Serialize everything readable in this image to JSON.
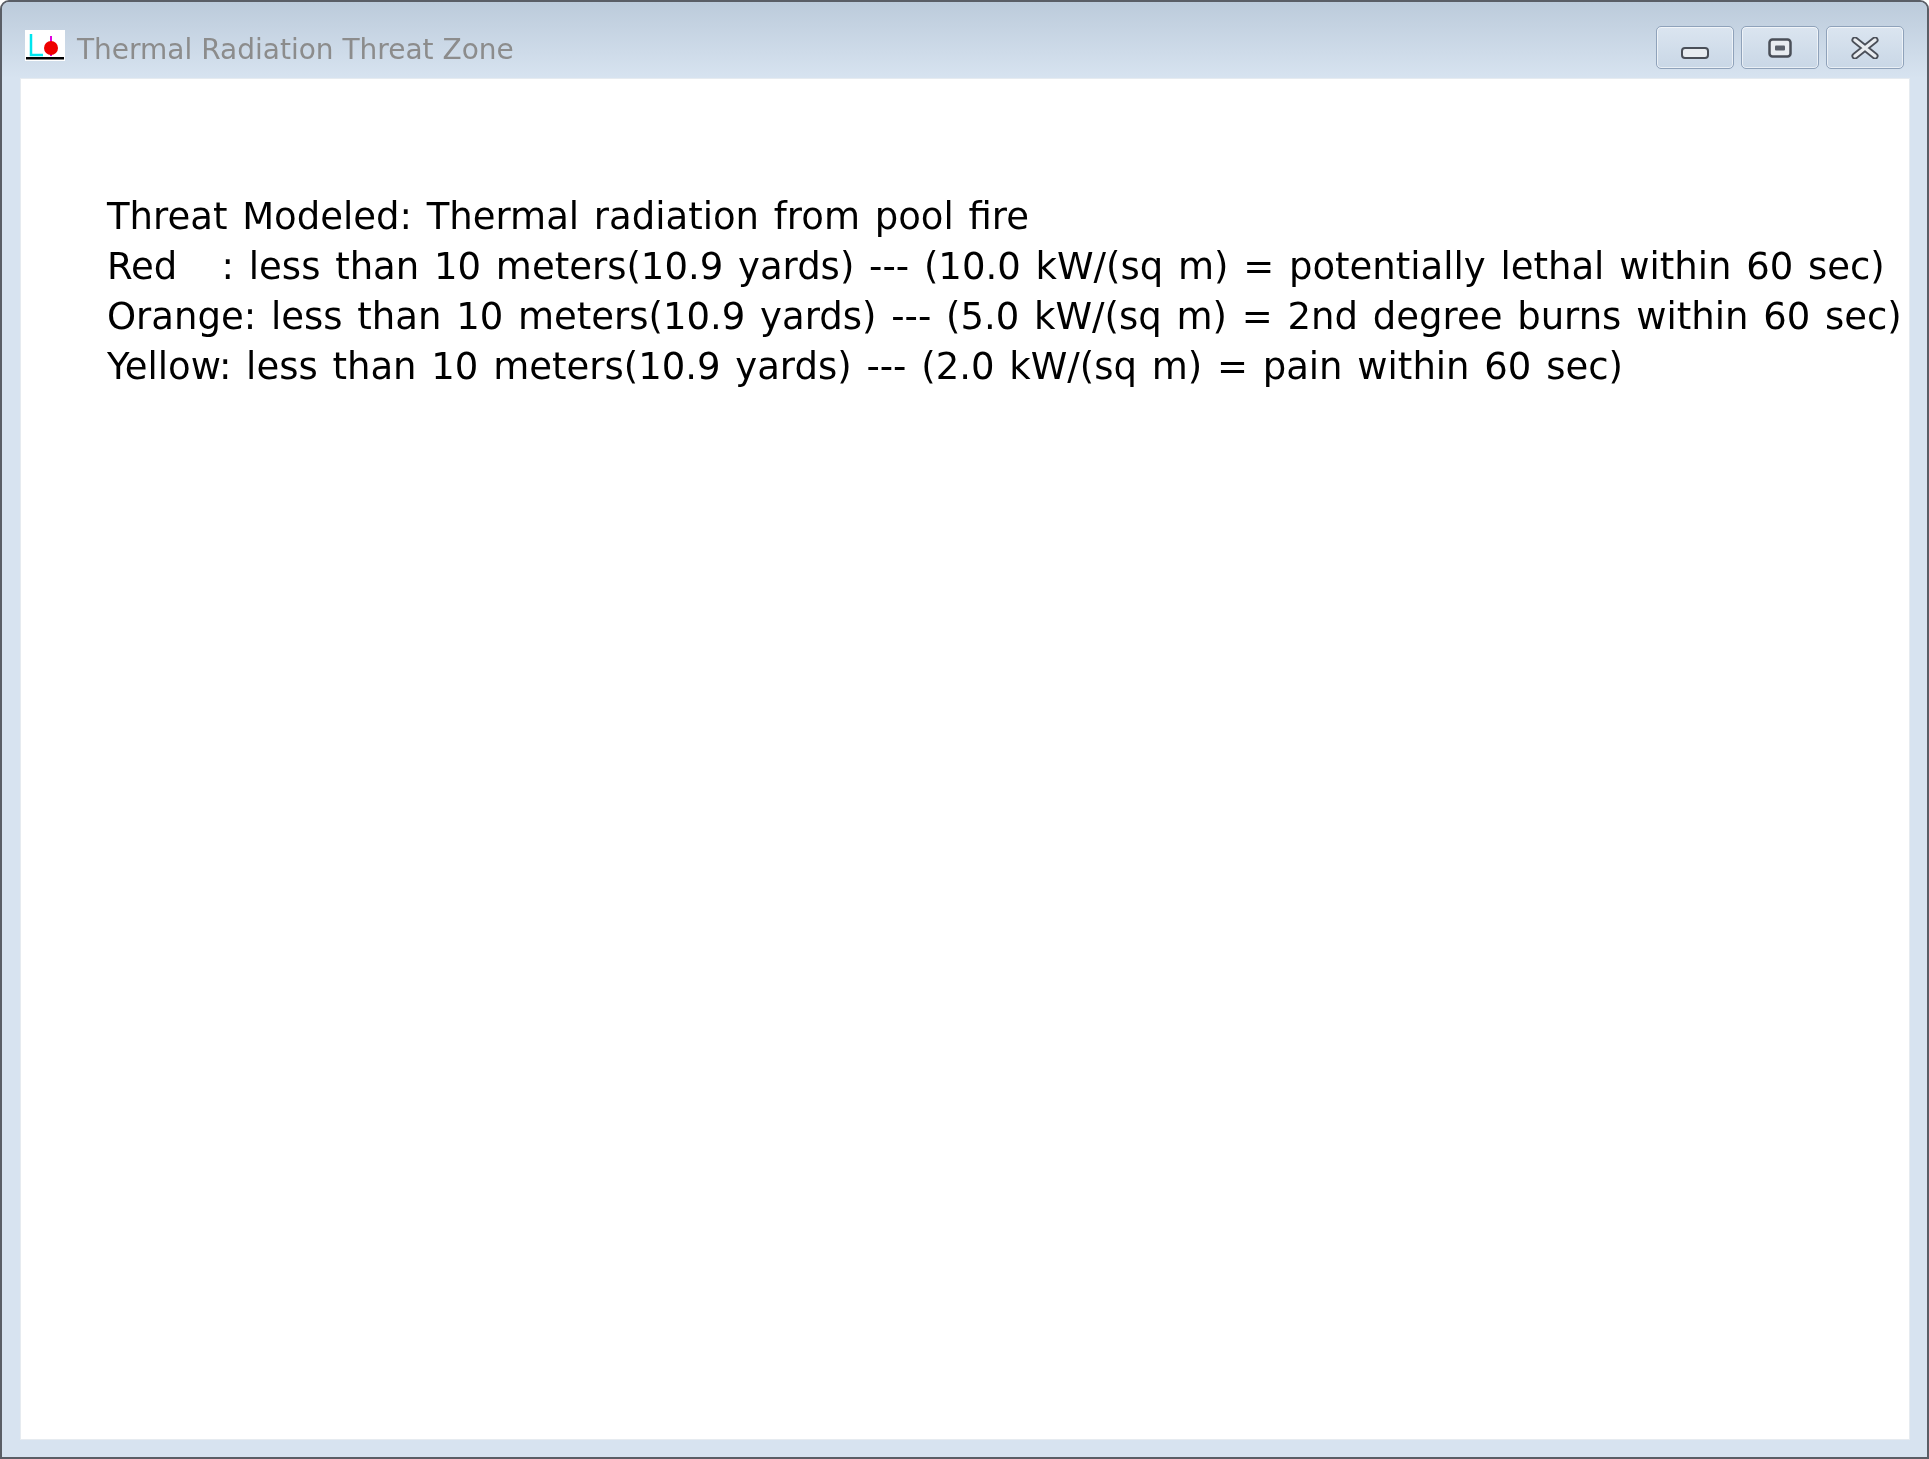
{
  "window": {
    "title": "Thermal Radiation Threat Zone",
    "active": false
  },
  "report": {
    "threat_modeled": "Threat Modeled: Thermal radiation from pool fire",
    "zones": [
      "Red   : less than 10 meters(10.9 yards) --- (10.0 kW/(sq m) = potentially lethal within 60 sec)",
      "Orange: less than 10 meters(10.9 yards) --- (5.0 kW/(sq m) = 2nd degree burns within 60 sec)",
      "Yellow: less than 10 meters(10.9 yards) --- (2.0 kW/(sq m) = pain within 60 sec)"
    ]
  }
}
